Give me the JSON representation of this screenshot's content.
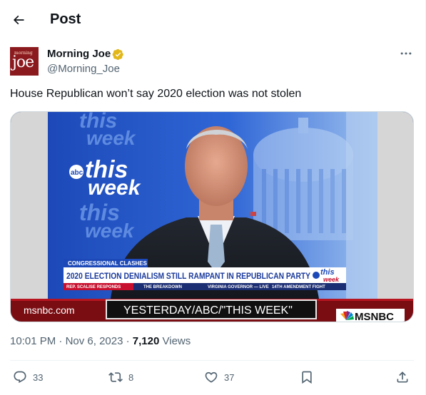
{
  "header": {
    "title": "Post",
    "back_icon": "arrow-left-icon"
  },
  "author": {
    "avatar_top_text": "morning",
    "avatar_brand_text": "joe",
    "name": "Morning Joe",
    "handle": "@Morning_Joe",
    "verified_icon": "gold-verified-badge-icon",
    "verified_color": "#e2b719"
  },
  "tweet": {
    "text": "House Republican won’t say 2020 election was not stolen"
  },
  "media": {
    "background_bug_line1": "this",
    "background_bug_line2": "week",
    "abc_logo_text": "abc",
    "lower_third_topic": "CONGRESSIONAL CLASHES",
    "headline": "2020 ELECTION DENIALISM STILL RAMPANT IN REPUBLICAN PARTY",
    "ticker_items": [
      "REP. SCALISE RESPONDS",
      "THE BREAKDOWN",
      "VIRGINIA GOVERNOR — LIVE",
      "14TH AMENDMENT FIGHT"
    ],
    "source_url": "msnbc.com",
    "source_caption": "YESTERDAY/ABC/\"THIS WEEK\"",
    "network": "MSNBC",
    "show_logo_line1": "this",
    "show_logo_line2": "week"
  },
  "meta": {
    "time": "10:01 PM",
    "separator": "·",
    "date": "Nov 6, 2023",
    "views_count": "7,120",
    "views_label": "Views"
  },
  "actions": {
    "replies": "33",
    "reposts": "8",
    "likes": "37",
    "reply_icon": "speech-bubble-icon",
    "repost_icon": "repost-icon",
    "like_icon": "heart-icon",
    "bookmark_icon": "bookmark-icon",
    "share_icon": "share-icon"
  }
}
